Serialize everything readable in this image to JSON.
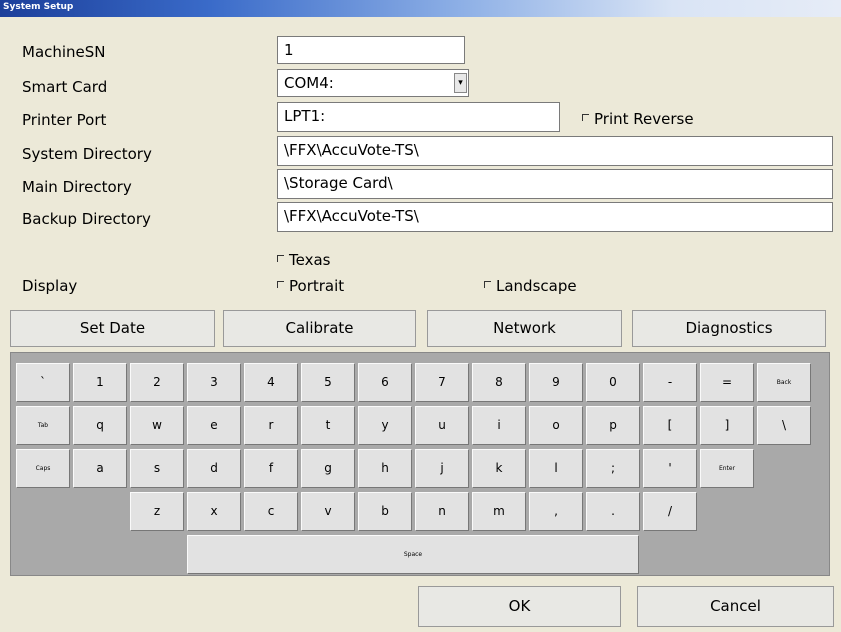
{
  "window": {
    "title": "System Setup"
  },
  "fields": {
    "machine_sn": {
      "label": "MachineSN",
      "value": "1"
    },
    "smart_card": {
      "label": "Smart Card",
      "value": "COM4:"
    },
    "printer_port": {
      "label": "Printer Port",
      "value": "LPT1:"
    },
    "system_directory": {
      "label": "System Directory",
      "value": "\\FFX\\AccuVote-TS\\"
    },
    "main_directory": {
      "label": "Main Directory",
      "value": "\\Storage Card\\"
    },
    "backup_directory": {
      "label": "Backup Directory",
      "value": "\\FFX\\AccuVote-TS\\"
    }
  },
  "checkboxes": {
    "print_reverse": "Print Reverse",
    "texas": "Texas",
    "portrait": "Portrait",
    "landscape": "Landscape"
  },
  "display_label": "Display",
  "buttons": {
    "set_date": "Set Date",
    "calibrate": "Calibrate",
    "network": "Network",
    "diagnostics": "Diagnostics",
    "ok": "OK",
    "cancel": "Cancel"
  },
  "keyboard": {
    "row1": [
      "`",
      "1",
      "2",
      "3",
      "4",
      "5",
      "6",
      "7",
      "8",
      "9",
      "0",
      "-",
      "=",
      "Back"
    ],
    "row2": [
      "Tab",
      "q",
      "w",
      "e",
      "r",
      "t",
      "y",
      "u",
      "i",
      "o",
      "p",
      "[",
      "]",
      "\\"
    ],
    "row3": [
      "Caps",
      "a",
      "s",
      "d",
      "f",
      "g",
      "h",
      "j",
      "k",
      "l",
      ";",
      "'",
      "Enter"
    ],
    "row4": [
      "z",
      "x",
      "c",
      "v",
      "b",
      "n",
      "m",
      ",",
      ".",
      "/"
    ],
    "space": "Space"
  }
}
